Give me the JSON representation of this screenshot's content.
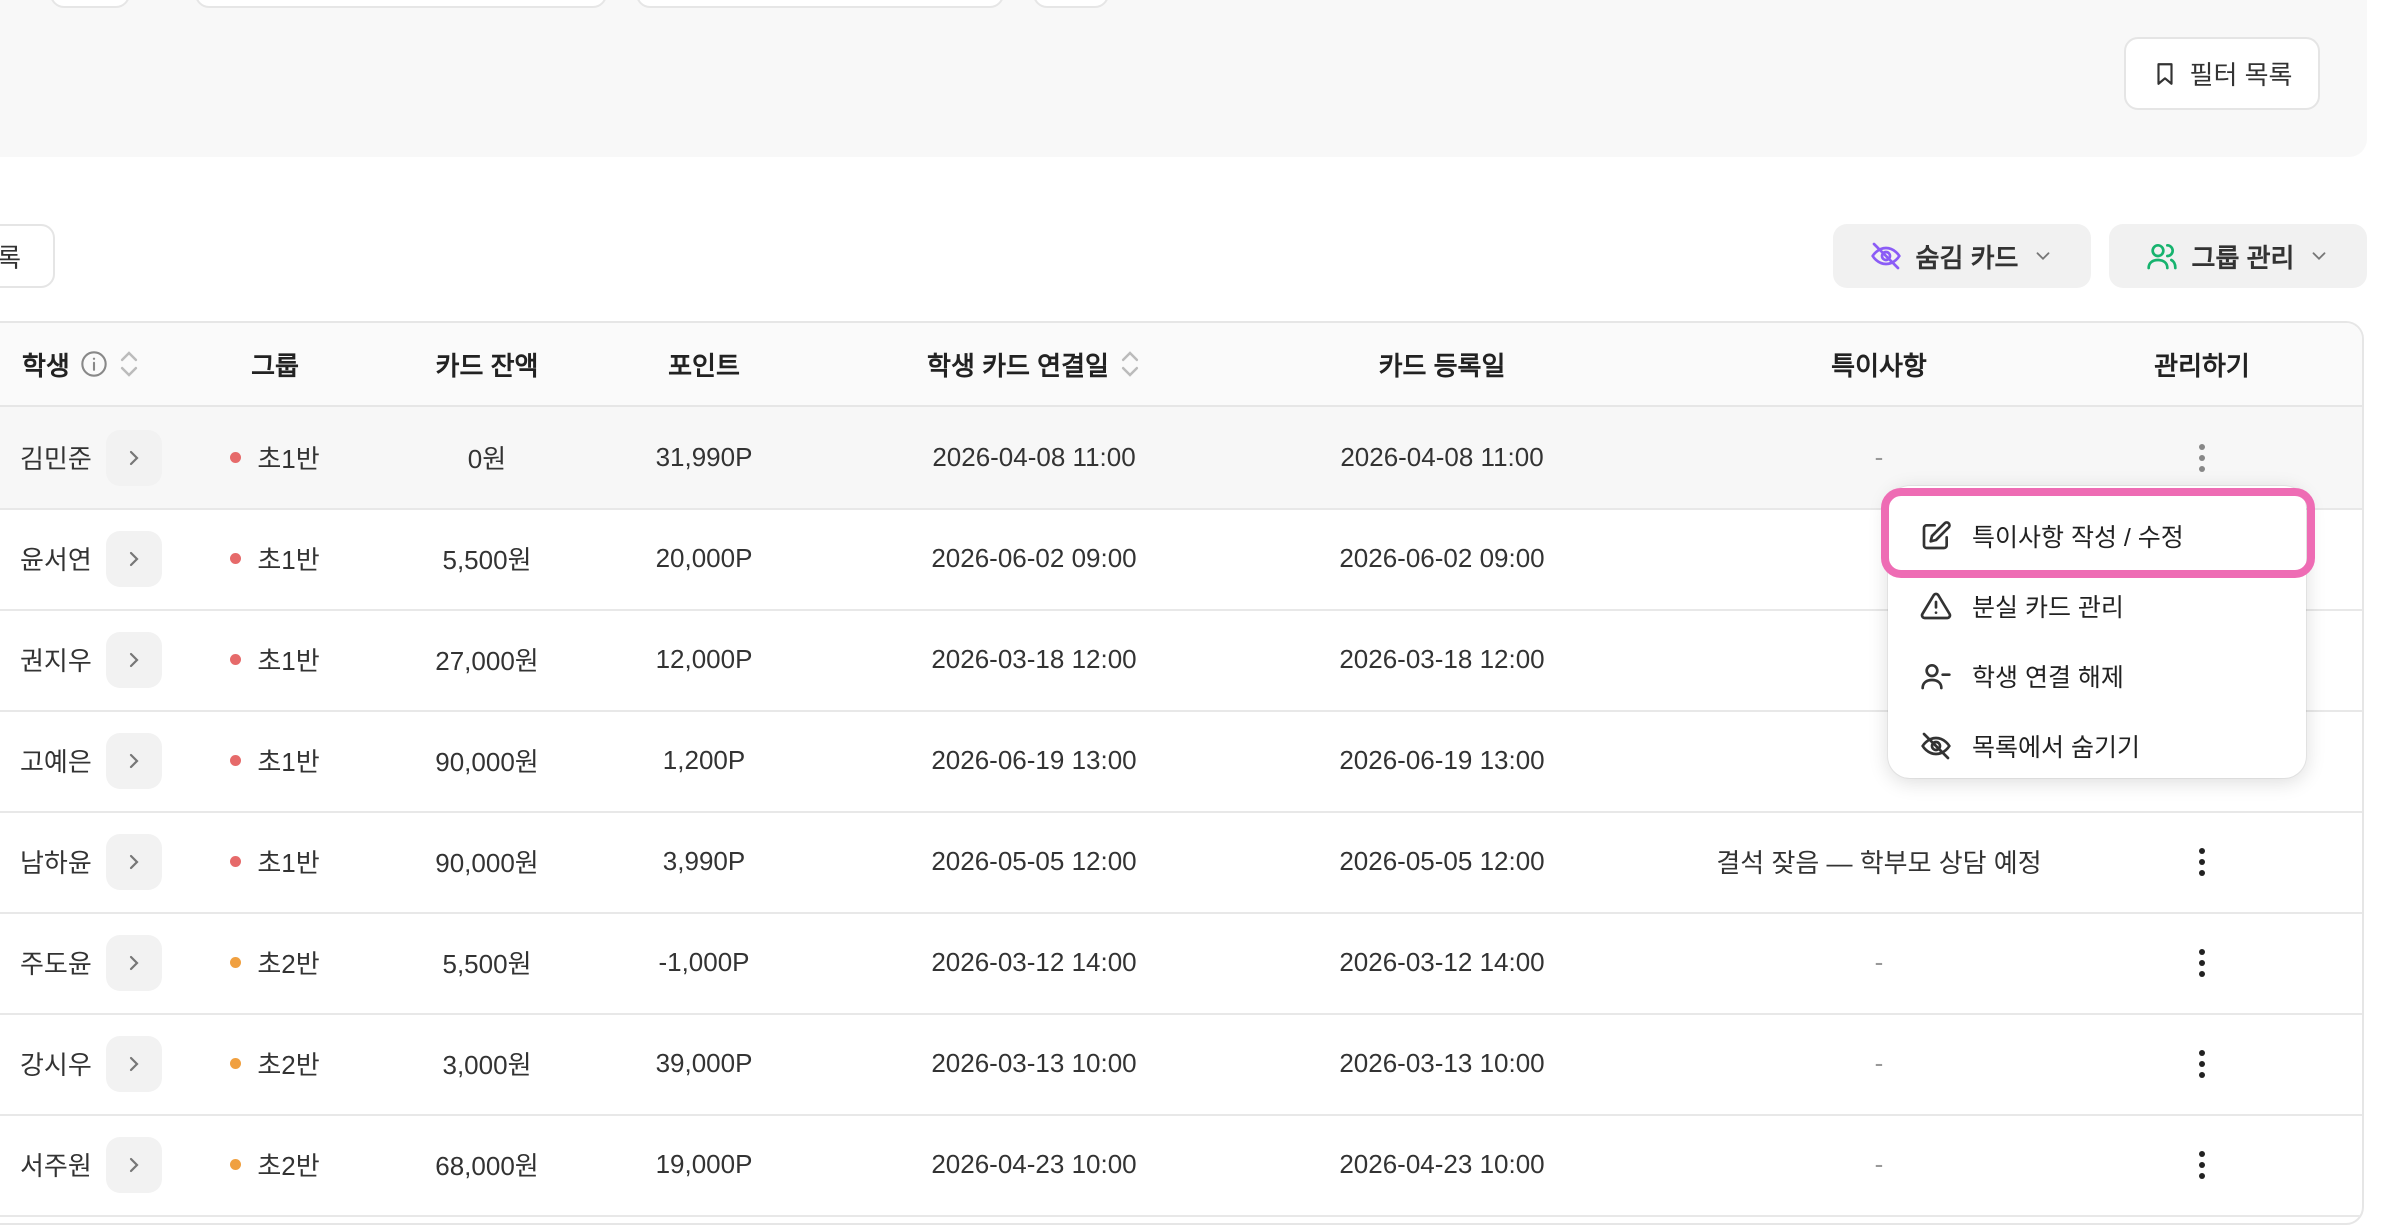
{
  "filter_panel": {
    "filter_list_label": "필터 목록"
  },
  "toolbar": {
    "left_button_partial": "록",
    "hidden_cards_label": "숨김 카드",
    "group_manage_label": "그룹 관리"
  },
  "table": {
    "headers": {
      "student": "학생",
      "group": "그룹",
      "card_balance": "카드 잔액",
      "points": "포인트",
      "card_link_date": "학생 카드 연결일",
      "card_register_date": "카드 등록일",
      "notes": "특이사항",
      "manage": "관리하기"
    },
    "rows": [
      {
        "name": "김민준",
        "group": "초1반",
        "balance": "0원",
        "points": "31,990P",
        "linked": "2026-04-08 11:00",
        "registered": "2026-04-08 11:00",
        "note": "-"
      },
      {
        "name": "윤서연",
        "group": "초1반",
        "balance": "5,500원",
        "points": "20,000P",
        "linked": "2026-06-02 09:00",
        "registered": "2026-06-02 09:00",
        "note": ""
      },
      {
        "name": "권지우",
        "group": "초1반",
        "balance": "27,000원",
        "points": "12,000P",
        "linked": "2026-03-18 12:00",
        "registered": "2026-03-18 12:00",
        "note": ""
      },
      {
        "name": "고예은",
        "group": "초1반",
        "balance": "90,000원",
        "points": "1,200P",
        "linked": "2026-06-19 13:00",
        "registered": "2026-06-19 13:00",
        "note": ""
      },
      {
        "name": "남하윤",
        "group": "초1반",
        "balance": "90,000원",
        "points": "3,990P",
        "linked": "2026-05-05 12:00",
        "registered": "2026-05-05 12:00",
        "note": "결석 잦음 — 학부모 상담 예정"
      },
      {
        "name": "주도윤",
        "group": "초2반",
        "balance": "5,500원",
        "points": "-1,000P",
        "linked": "2026-03-12 14:00",
        "registered": "2026-03-12 14:00",
        "note": "-"
      },
      {
        "name": "강시우",
        "group": "초2반",
        "balance": "3,000원",
        "points": "39,000P",
        "linked": "2026-03-13 10:00",
        "registered": "2026-03-13 10:00",
        "note": "-"
      },
      {
        "name": "서주원",
        "group": "초2반",
        "balance": "68,000원",
        "points": "19,000P",
        "linked": "2026-04-23 10:00",
        "registered": "2026-04-23 10:00",
        "note": "-"
      }
    ]
  },
  "context_menu": {
    "items": [
      {
        "label": "특이사항 작성 / 수정",
        "icon": "edit-icon"
      },
      {
        "label": "분실 카드 관리",
        "icon": "warning-icon"
      },
      {
        "label": "학생 연결 해제",
        "icon": "user-minus-icon"
      },
      {
        "label": "목록에서 숨기기",
        "icon": "eye-off-icon"
      }
    ]
  },
  "colors": {
    "group_1_dot": "#e66a6a",
    "group_2_dot": "#f0a040",
    "hidden_icon": "#8b5cf6",
    "group_icon": "#16b36e",
    "highlight": "#ee6cb4"
  }
}
